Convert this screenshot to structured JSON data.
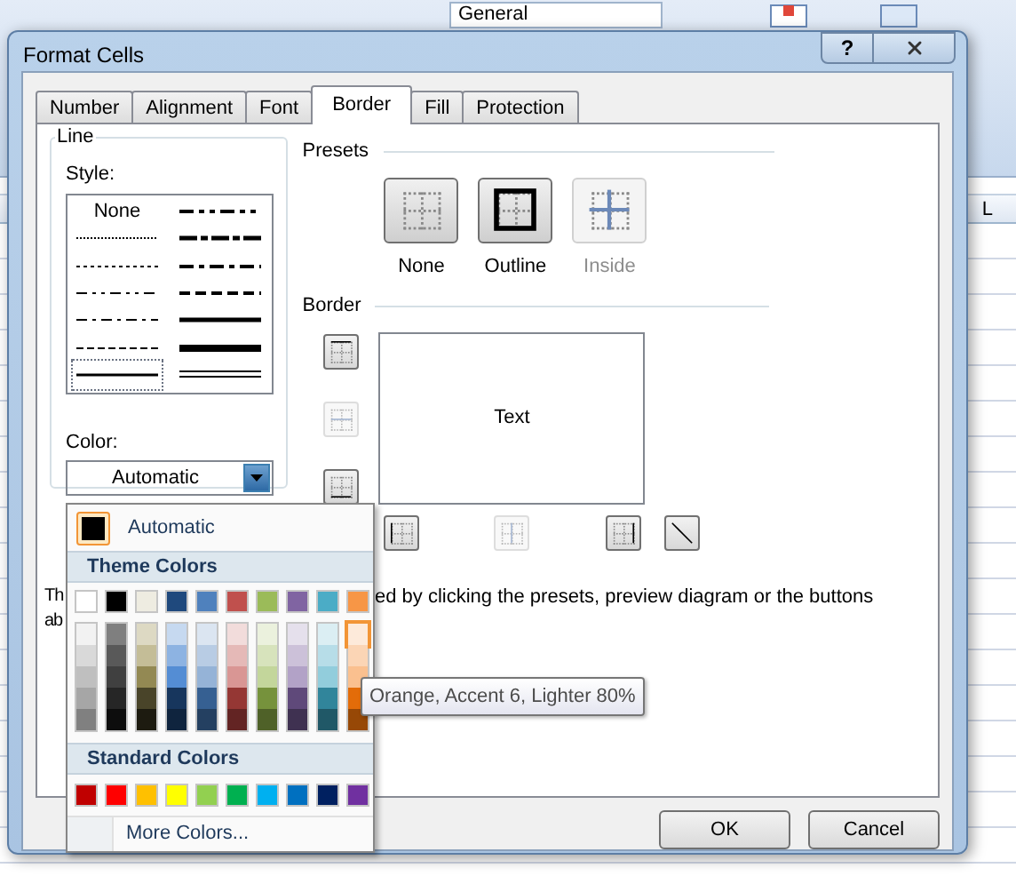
{
  "ribbon": {
    "number_format": "General"
  },
  "sheet": {
    "column_header": "L"
  },
  "window": {
    "title": "Format Cells",
    "help_button": "?"
  },
  "tabs": [
    {
      "label": "Number",
      "selected": false
    },
    {
      "label": "Alignment",
      "selected": false
    },
    {
      "label": "Font",
      "selected": false
    },
    {
      "label": "Border",
      "selected": true
    },
    {
      "label": "Fill",
      "selected": false
    },
    {
      "label": "Protection",
      "selected": false
    }
  ],
  "line": {
    "title": "Line",
    "style_label": "Style:",
    "color_label": "Color:",
    "color_value": "Automatic"
  },
  "line_styles": [
    {
      "kind": "none",
      "label": "None",
      "selected": false
    },
    {
      "kind": "dotted",
      "selected": false
    },
    {
      "kind": "hair",
      "selected": false
    },
    {
      "kind": "dashdotdot",
      "selected": false
    },
    {
      "kind": "dashdot",
      "selected": false
    },
    {
      "kind": "dashed",
      "selected": false
    },
    {
      "kind": "thin",
      "selected": true
    },
    {
      "kind": "medium-dashdotdot",
      "selected": false
    },
    {
      "kind": "slant-dashdot",
      "selected": false
    },
    {
      "kind": "medium-dashdot",
      "selected": false
    },
    {
      "kind": "medium-dashed",
      "selected": false
    },
    {
      "kind": "medium",
      "selected": false
    },
    {
      "kind": "thick",
      "selected": false
    },
    {
      "kind": "double",
      "selected": false
    }
  ],
  "presets": {
    "title": "Presets",
    "items": [
      {
        "kind": "none",
        "label": "None",
        "disabled": false
      },
      {
        "kind": "outline",
        "label": "Outline",
        "disabled": false
      },
      {
        "kind": "inside",
        "label": "Inside",
        "disabled": true
      }
    ]
  },
  "border": {
    "title": "Border",
    "preview_text": "Text",
    "side_buttons": [
      {
        "kind": "top",
        "disabled": false
      },
      {
        "kind": "middle",
        "disabled": true
      },
      {
        "kind": "bottom",
        "disabled": false
      }
    ],
    "bottom_buttons": [
      {
        "kind": "left",
        "disabled": false
      },
      {
        "kind": "center",
        "disabled": true
      },
      {
        "kind": "right",
        "disabled": false
      },
      {
        "kind": "diagonal",
        "disabled": false
      }
    ]
  },
  "note": {
    "left_lines": [
      "Th",
      "ab"
    ],
    "right": "ed by clicking the presets, preview diagram or the buttons"
  },
  "buttons": [
    "OK",
    "Cancel"
  ],
  "color_menu": {
    "automatic": {
      "label": "Automatic",
      "selected": true
    },
    "theme_title": "Theme Colors",
    "theme": [
      {
        "color": "#ffffff",
        "highlighted": false
      },
      {
        "color": "#000000",
        "highlighted": false
      },
      {
        "color": "#eeece1",
        "highlighted": false
      },
      {
        "color": "#1f497d",
        "highlighted": false
      },
      {
        "color": "#4f81bd",
        "highlighted": false
      },
      {
        "color": "#c0504d",
        "highlighted": false
      },
      {
        "color": "#9bbb59",
        "highlighted": false
      },
      {
        "color": "#8064a2",
        "highlighted": false
      },
      {
        "color": "#4bacc6",
        "highlighted": false
      },
      {
        "color": "#f79646",
        "highlighted": false
      }
    ],
    "tints": [
      [
        {
          "color": "#f2f2f2",
          "highlighted": false
        },
        {
          "color": "#d9d9d9",
          "highlighted": false
        },
        {
          "color": "#bfbfbf",
          "highlighted": false
        },
        {
          "color": "#a6a6a6",
          "highlighted": false
        },
        {
          "color": "#808080",
          "highlighted": false
        }
      ],
      [
        {
          "color": "#7f7f7f",
          "highlighted": false
        },
        {
          "color": "#595959",
          "highlighted": false
        },
        {
          "color": "#404040",
          "highlighted": false
        },
        {
          "color": "#262626",
          "highlighted": false
        },
        {
          "color": "#0d0d0d",
          "highlighted": false
        }
      ],
      [
        {
          "color": "#ddd9c3",
          "highlighted": false
        },
        {
          "color": "#c4bd97",
          "highlighted": false
        },
        {
          "color": "#938953",
          "highlighted": false
        },
        {
          "color": "#494429",
          "highlighted": false
        },
        {
          "color": "#1d1b10",
          "highlighted": false
        }
      ],
      [
        {
          "color": "#c6d9f0",
          "highlighted": false
        },
        {
          "color": "#8db3e2",
          "highlighted": false
        },
        {
          "color": "#548dd4",
          "highlighted": false
        },
        {
          "color": "#17365d",
          "highlighted": false
        },
        {
          "color": "#0f243e",
          "highlighted": false
        }
      ],
      [
        {
          "color": "#dbe5f1",
          "highlighted": false
        },
        {
          "color": "#b8cce4",
          "highlighted": false
        },
        {
          "color": "#95b3d7",
          "highlighted": false
        },
        {
          "color": "#366092",
          "highlighted": false
        },
        {
          "color": "#244061",
          "highlighted": false
        }
      ],
      [
        {
          "color": "#f2dcdb",
          "highlighted": false
        },
        {
          "color": "#e5b9b7",
          "highlighted": false
        },
        {
          "color": "#d99694",
          "highlighted": false
        },
        {
          "color": "#953734",
          "highlighted": false
        },
        {
          "color": "#632423",
          "highlighted": false
        }
      ],
      [
        {
          "color": "#ebf1dd",
          "highlighted": false
        },
        {
          "color": "#d7e3bc",
          "highlighted": false
        },
        {
          "color": "#c3d69b",
          "highlighted": false
        },
        {
          "color": "#76923c",
          "highlighted": false
        },
        {
          "color": "#4f6128",
          "highlighted": false
        }
      ],
      [
        {
          "color": "#e5e0ec",
          "highlighted": false
        },
        {
          "color": "#ccc1d9",
          "highlighted": false
        },
        {
          "color": "#b2a2c7",
          "highlighted": false
        },
        {
          "color": "#5f497a",
          "highlighted": false
        },
        {
          "color": "#3f3151",
          "highlighted": false
        }
      ],
      [
        {
          "color": "#dbeef3",
          "highlighted": false
        },
        {
          "color": "#b7dde8",
          "highlighted": false
        },
        {
          "color": "#92cddc",
          "highlighted": false
        },
        {
          "color": "#31859b",
          "highlighted": false
        },
        {
          "color": "#205867",
          "highlighted": false
        }
      ],
      [
        {
          "color": "#fdeada",
          "highlighted": true
        },
        {
          "color": "#fbd5b5",
          "highlighted": false
        },
        {
          "color": "#fac08f",
          "highlighted": false
        },
        {
          "color": "#e36c09",
          "highlighted": false
        },
        {
          "color": "#974806",
          "highlighted": false
        }
      ]
    ],
    "standard_title": "Standard Colors",
    "standard": [
      {
        "color": "#c00000",
        "highlighted": false
      },
      {
        "color": "#ff0000",
        "highlighted": false
      },
      {
        "color": "#ffc000",
        "highlighted": false
      },
      {
        "color": "#ffff00",
        "highlighted": false
      },
      {
        "color": "#92d050",
        "highlighted": false
      },
      {
        "color": "#00b050",
        "highlighted": false
      },
      {
        "color": "#00b0f0",
        "highlighted": false
      },
      {
        "color": "#0070c0",
        "highlighted": false
      },
      {
        "color": "#002060",
        "highlighted": false
      },
      {
        "color": "#7030a0",
        "highlighted": false
      }
    ],
    "more_colors": "More Colors..."
  },
  "tooltip": "Orange, Accent 6, Lighter 80%"
}
